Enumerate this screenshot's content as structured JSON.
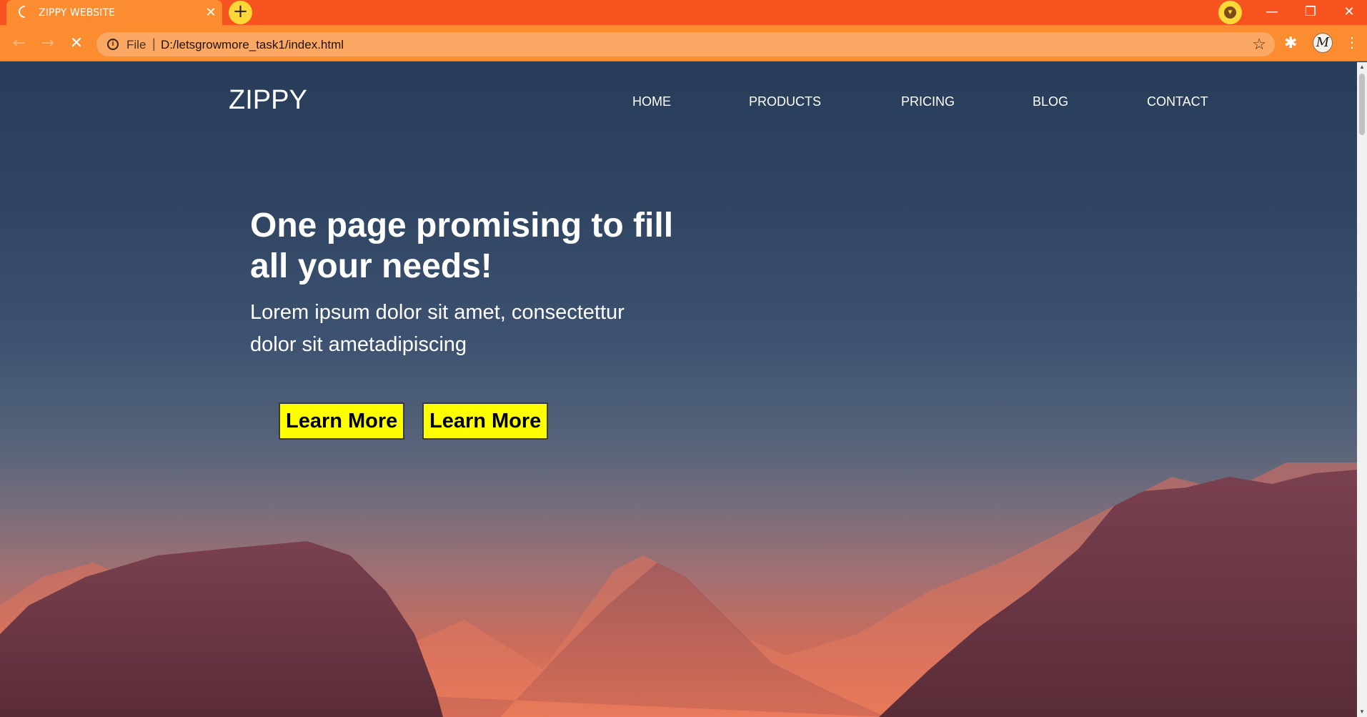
{
  "browser": {
    "tab_title": "ZIPPY WEBSITE",
    "tab_close": "✕",
    "new_tab": "+",
    "url_scheme": "File",
    "url_separator": "|",
    "url": "D:/letsgrowmore_task1/index.html",
    "icons": [
      "tab-loading-spinner",
      "new-tab-plus",
      "download-icon",
      "minimize",
      "restore",
      "close",
      "back-arrow",
      "forward-arrow",
      "stop-loading-x",
      "info-icon",
      "bookmark-star",
      "extensions-puzzle",
      "profile-avatar",
      "kebab-menu"
    ],
    "avatar_initial": "M",
    "window_controls": {
      "minimize": "—",
      "restore": "❐",
      "close": "✕"
    },
    "nav": {
      "back": "←",
      "forward": "→",
      "stop": "✕"
    },
    "colors": {
      "tabbar": "#f7531f",
      "toolbar": "#fb8c2f",
      "omnibox": "#fba865",
      "accent": "#fdd836"
    }
  },
  "site": {
    "logo": "ZIPPY",
    "nav": [
      {
        "label": "HOME"
      },
      {
        "label": "PRODUCTS"
      },
      {
        "label": "PRICING"
      },
      {
        "label": "BLOG"
      },
      {
        "label": "CONTACT"
      }
    ],
    "hero": {
      "title": "One page promising to fill all your needs!",
      "text": "Lorem ipsum dolor sit amet, consectettur dolor sit ametadipiscing",
      "buttons": [
        {
          "label": "Learn More"
        },
        {
          "label": "Learn More"
        }
      ]
    },
    "colors": {
      "button_bg": "#ffff00",
      "sky_top": "#283d5a",
      "horizon": "#ef7b58",
      "mountain_dark": "#5a2c38"
    }
  }
}
